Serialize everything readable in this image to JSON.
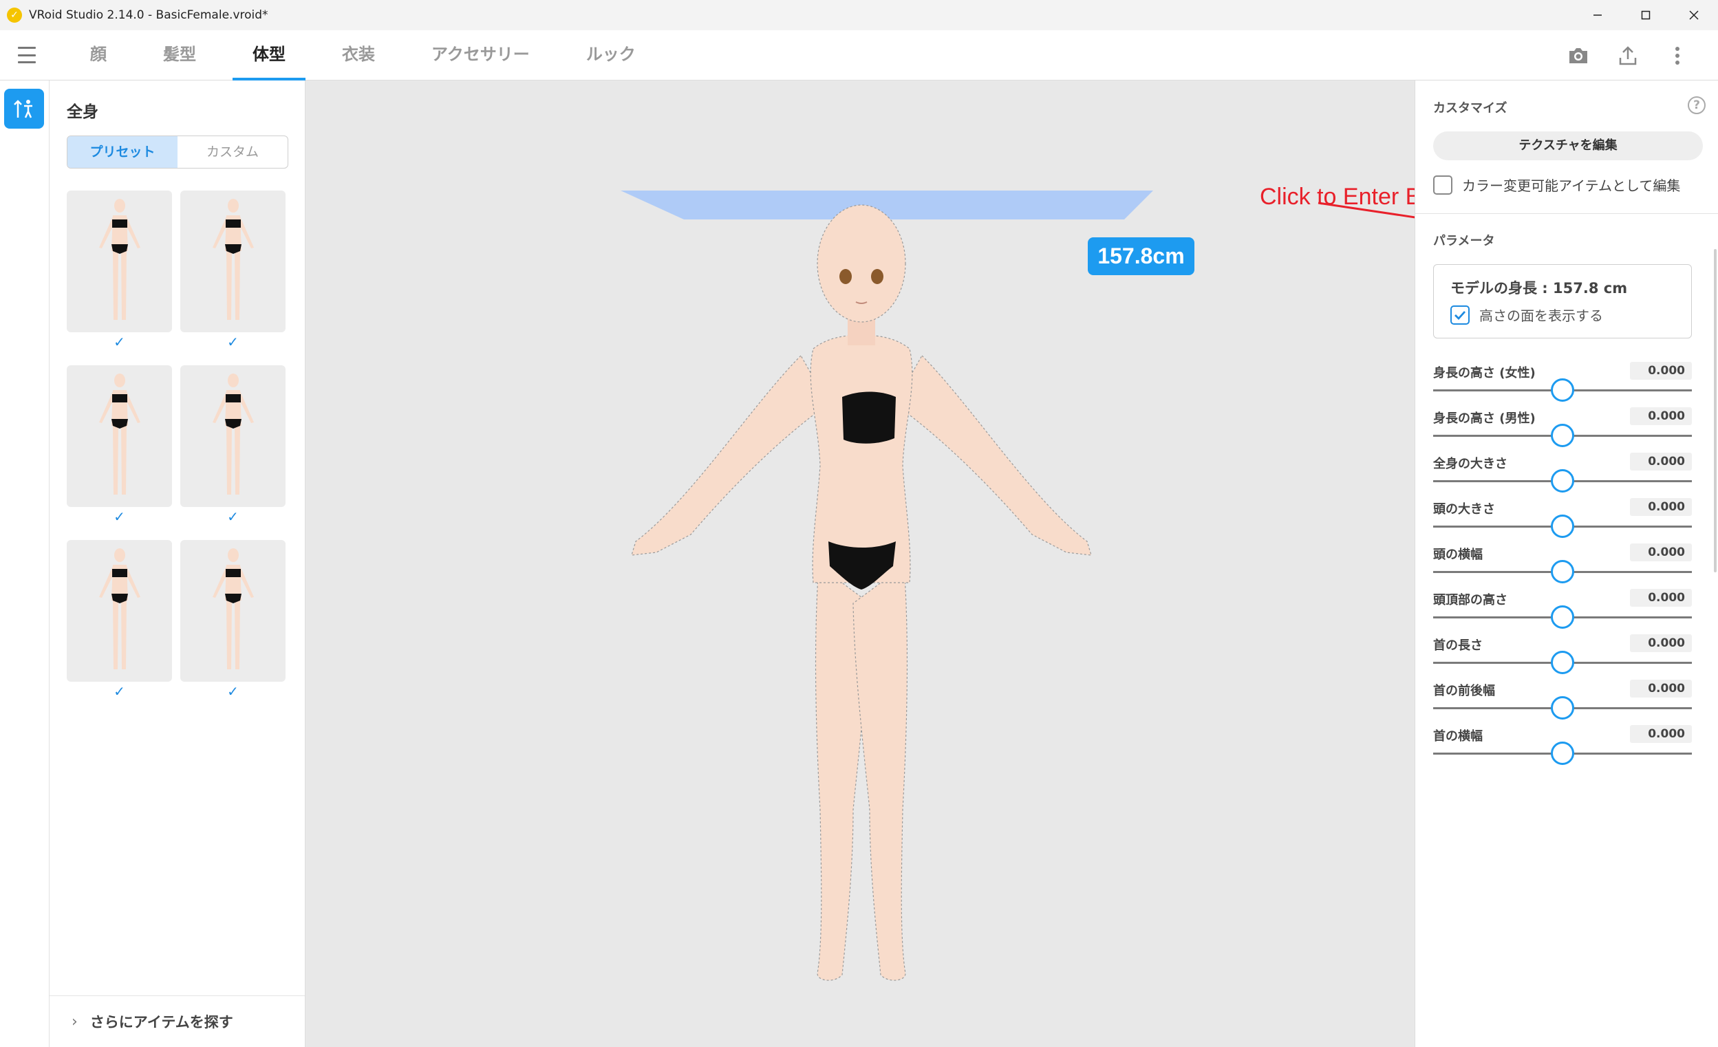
{
  "window": {
    "title": "VRoid Studio 2.14.0 - BasicFemale.vroid*"
  },
  "tabs": [
    {
      "label": "顔"
    },
    {
      "label": "髪型"
    },
    {
      "label": "体型",
      "active": true
    },
    {
      "label": "衣装"
    },
    {
      "label": "アクセサリー"
    },
    {
      "label": "ルック"
    }
  ],
  "toolbar_icons": [
    "camera-icon",
    "export-icon",
    "more-vertical-icon"
  ],
  "left_panel": {
    "title": "全身",
    "segments": {
      "preset": "プリセット",
      "custom": "カスタム",
      "selected": "preset"
    },
    "presets": [
      {
        "checked": true
      },
      {
        "checked": true
      },
      {
        "checked": true
      },
      {
        "checked": true
      },
      {
        "checked": true
      },
      {
        "checked": true
      }
    ],
    "more_items": "さらにアイテムを探す"
  },
  "viewport": {
    "height_badge": "157.8cm",
    "annotation": "Click to Enter Body Texture Mode"
  },
  "right_panel": {
    "customize_heading": "カスタマイズ",
    "edit_texture_button": "テクスチャを編集",
    "color_edit_checkbox": {
      "label": "カラー変更可能アイテムとして編集",
      "checked": false
    },
    "parameters_heading": "パラメータ",
    "model_height": {
      "label": "モデルの身長 : 157.8 cm",
      "checkbox_label": "高さの面を表示する",
      "checked": true
    },
    "parameters": [
      {
        "label": "身長の高さ (女性)",
        "value": "0.000"
      },
      {
        "label": "身長の高さ (男性)",
        "value": "0.000"
      },
      {
        "label": "全身の大きさ",
        "value": "0.000"
      },
      {
        "label": "頭の大きさ",
        "value": "0.000"
      },
      {
        "label": "頭の横幅",
        "value": "0.000"
      },
      {
        "label": "頭頂部の高さ",
        "value": "0.000"
      },
      {
        "label": "首の長さ",
        "value": "0.000"
      },
      {
        "label": "首の前後幅",
        "value": "0.000"
      },
      {
        "label": "首の横幅",
        "value": "0.000"
      }
    ],
    "slider_fraction": 0.5
  },
  "colors": {
    "accent": "#1d9bf0",
    "annotation": "#e8202a",
    "height_plane": "#a8c8f8",
    "skin": "#f8dccb",
    "clothing": "#111111"
  }
}
